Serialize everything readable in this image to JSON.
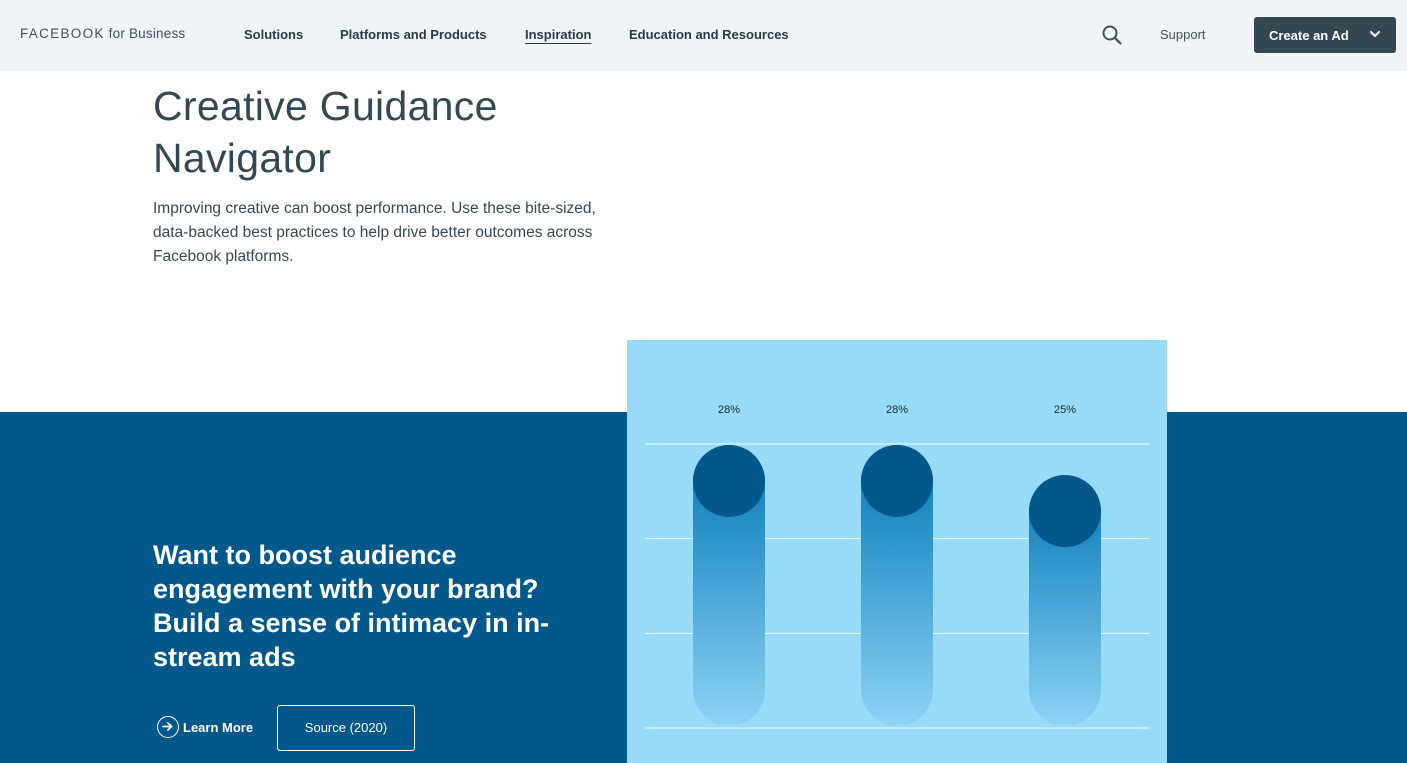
{
  "nav": {
    "logo_brand": "FACEBOOK",
    "logo_suffix": "for Business",
    "links": [
      {
        "label": "Solutions"
      },
      {
        "label": "Platforms and Products"
      },
      {
        "label": "Inspiration"
      },
      {
        "label": "Education and Resources"
      }
    ],
    "search_icon": "search-icon",
    "support_label": "Support",
    "cta_label": "Create an Ad",
    "cta_icon": "chevron-down-icon"
  },
  "hero": {
    "title": "Creative Guidance Navigator",
    "description": "Improving creative can boost performance. Use these bite-sized, data-backed best practices to help drive better outcomes across Facebook platforms."
  },
  "band": {
    "title": "Want to boost audience engagement with your brand? Build a sense of intimacy in in-stream ads",
    "learn_more_label": "Learn More",
    "learn_more_icon": "arrow-right-circle-icon",
    "source_label": "Source (2020)"
  },
  "colors": {
    "nav_bg": "#f1f4f5",
    "band_bg": "#02578b",
    "chart_bg": "#98dbf9",
    "cta_bg": "#344854",
    "bar_cap": "#02578b"
  },
  "chart_data": {
    "type": "bar",
    "values": [
      28,
      28,
      25
    ],
    "value_labels": [
      "28%",
      "28%",
      "25%"
    ],
    "ylim": [
      0,
      28
    ],
    "grid": true
  }
}
